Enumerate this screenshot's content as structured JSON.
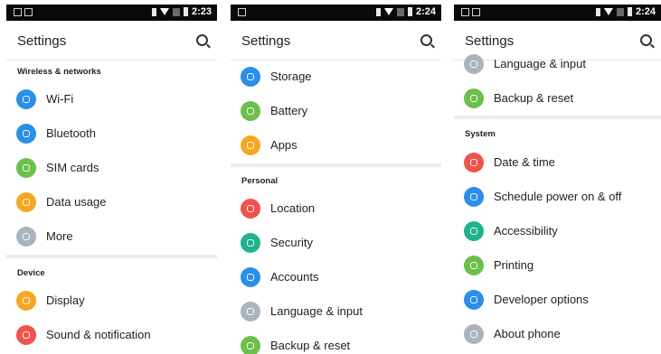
{
  "screens": [
    {
      "time": "2:23",
      "title": "Settings",
      "sections": [
        {
          "header": "Wireless & networks",
          "items": [
            {
              "label": "Wi-Fi",
              "icon": "wifi-icon",
              "color": "#2a8fe8"
            },
            {
              "label": "Bluetooth",
              "icon": "bluetooth-icon",
              "color": "#2a8fe8"
            },
            {
              "label": "SIM cards",
              "icon": "sim-card-icon",
              "color": "#6cbf4a"
            },
            {
              "label": "Data usage",
              "icon": "data-usage-icon",
              "color": "#f5a623"
            },
            {
              "label": "More",
              "icon": "more-icon",
              "color": "#a9b4bf"
            }
          ]
        },
        {
          "header": "Device",
          "items": [
            {
              "label": "Display",
              "icon": "display-icon",
              "color": "#f5a623"
            },
            {
              "label": "Sound & notification",
              "icon": "sound-icon",
              "color": "#f0534a"
            }
          ]
        }
      ]
    },
    {
      "time": "2:24",
      "title": "Settings",
      "sections": [
        {
          "header": "",
          "items": [
            {
              "label": "Storage",
              "icon": "storage-icon",
              "color": "#2a8fe8"
            },
            {
              "label": "Battery",
              "icon": "battery-icon",
              "color": "#6cbf4a"
            },
            {
              "label": "Apps",
              "icon": "apps-icon",
              "color": "#f5a623"
            }
          ]
        },
        {
          "header": "Personal",
          "items": [
            {
              "label": "Location",
              "icon": "location-icon",
              "color": "#f0534a"
            },
            {
              "label": "Security",
              "icon": "security-icon",
              "color": "#1fb38e"
            },
            {
              "label": "Accounts",
              "icon": "accounts-icon",
              "color": "#2a8fe8"
            },
            {
              "label": "Language & input",
              "icon": "language-icon",
              "color": "#a9b4bf"
            },
            {
              "label": "Backup & reset",
              "icon": "backup-icon",
              "color": "#6cbf4a"
            }
          ]
        }
      ]
    },
    {
      "time": "2:24",
      "title": "Settings",
      "sections": [
        {
          "header": "",
          "items": [
            {
              "label": "Language & input",
              "icon": "language-icon",
              "color": "#a9b4bf"
            },
            {
              "label": "Backup & reset",
              "icon": "backup-icon",
              "color": "#6cbf4a"
            }
          ]
        },
        {
          "header": "System",
          "items": [
            {
              "label": "Date & time",
              "icon": "clock-icon",
              "color": "#f0534a"
            },
            {
              "label": "Schedule power on & off",
              "icon": "power-icon",
              "color": "#2a8fe8"
            },
            {
              "label": "Accessibility",
              "icon": "accessibility-icon",
              "color": "#1fb38e"
            },
            {
              "label": "Printing",
              "icon": "printer-icon",
              "color": "#6cbf4a"
            },
            {
              "label": "Developer options",
              "icon": "developer-icon",
              "color": "#2a8fe8"
            },
            {
              "label": "About phone",
              "icon": "info-icon",
              "color": "#a9b4bf"
            }
          ]
        }
      ]
    }
  ]
}
